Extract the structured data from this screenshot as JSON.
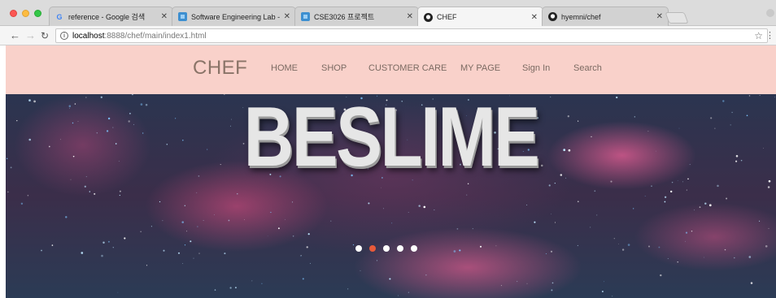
{
  "browser": {
    "tabs": [
      {
        "title": "reference - Google 검색",
        "icon": "google-g-icon",
        "active": false
      },
      {
        "title": "Software Engineering Lab - Co",
        "icon": "blue-square-icon",
        "active": false
      },
      {
        "title": "CSE3026 프로젝트",
        "icon": "blue-square-icon",
        "active": false
      },
      {
        "title": "CHEF",
        "icon": "github-octocat-icon",
        "active": true
      },
      {
        "title": "hyemni/chef",
        "icon": "github-octocat-icon",
        "active": false
      }
    ],
    "url": {
      "host": "localhost",
      "path": ":8888/chef/main/index1.html"
    }
  },
  "site": {
    "logo": "CHEF",
    "nav": [
      {
        "label": "HOME"
      },
      {
        "label": "SHOP"
      },
      {
        "label": "CUSTOMER CARE"
      },
      {
        "label": "MY PAGE"
      },
      {
        "label": "Sign In"
      },
      {
        "label": "Search"
      }
    ],
    "hero": {
      "title": "BESLIME",
      "slide_count": 5,
      "active_slide": 2
    }
  },
  "colors": {
    "nav_bg": "#f9d1ca",
    "nav_text": "#7b6a62",
    "logo": "#8a7468",
    "active_dot": "#e85a3a"
  }
}
